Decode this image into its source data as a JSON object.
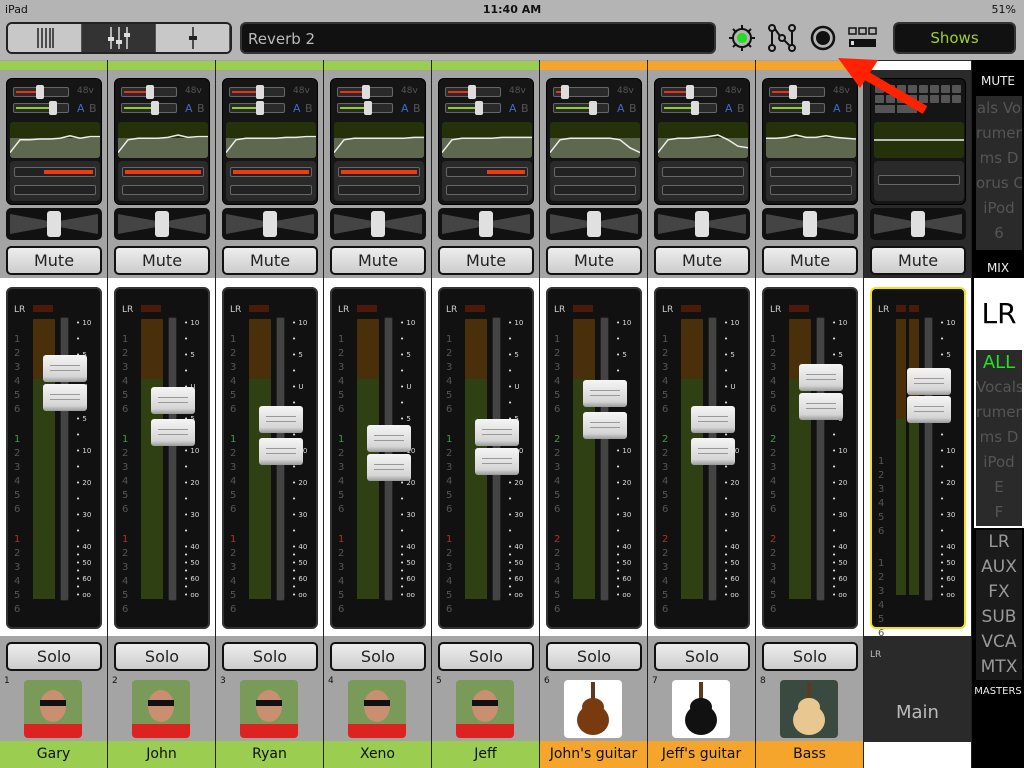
{
  "status": {
    "device": "iPad",
    "time": "11:40 AM",
    "battery": "51%"
  },
  "toolbar": {
    "views": [
      "channels-overview-icon",
      "mixer-faders-icon",
      "single-fader-icon"
    ],
    "active_view": 1,
    "scene_name": "Reverb 2",
    "shows_label": "Shows",
    "icons": [
      "gear-icon",
      "routing-icon",
      "record-icon",
      "layout-icon"
    ],
    "gear_status_color": "#22dd22"
  },
  "colors": {
    "green_group": "#9acd50",
    "orange_group": "#f5a52c",
    "meter_green": "#2f4012",
    "meter_orange": "#4a300a",
    "annotation_arrow": "#ff2200"
  },
  "fader_scale": [
    "10",
    "",
    "5",
    "",
    "U",
    "",
    "5",
    "",
    "10",
    "",
    "20",
    "",
    "30",
    "",
    "40",
    "",
    "50",
    "",
    "60",
    "",
    "oo"
  ],
  "meter_numbers": [
    "1",
    "2",
    "3",
    "4",
    "5",
    "6"
  ],
  "channels": [
    {
      "index": "1",
      "name": "Gary",
      "group": "green",
      "phantom": "48v",
      "ab": [
        "A",
        "B"
      ],
      "gain": 0.45,
      "trim": 0.72,
      "comp": [
        0.35,
        1
      ],
      "gate": null,
      "eq": [
        -9,
        -1,
        -1,
        -0.5,
        -0.5,
        0,
        1.5,
        0,
        1,
        1
      ],
      "fader_db": [
        3,
        -1.5
      ],
      "pan": 0,
      "mute": "Mute",
      "solo": "Solo",
      "photo": "person",
      "meter_marks": [
        "1",
        "1"
      ]
    },
    {
      "index": "2",
      "name": "John",
      "group": "green",
      "phantom": "48v",
      "ab": [
        "A",
        "B"
      ],
      "gain": 0.5,
      "trim": 0.6,
      "comp": [
        0,
        1
      ],
      "gate": null,
      "eq": [
        -9,
        -1,
        0,
        0,
        0,
        0.5,
        2,
        0.5,
        1,
        1
      ],
      "fader_db": [
        -2,
        -7
      ],
      "pan": 0,
      "mute": "Mute",
      "solo": "Solo",
      "photo": "person",
      "meter_marks": [
        "1",
        "1"
      ]
    },
    {
      "index": "3",
      "name": "Ryan",
      "group": "green",
      "phantom": "48v",
      "ab": [
        "A",
        "B"
      ],
      "gain": 0.55,
      "trim": 0.55,
      "comp": [
        0,
        1
      ],
      "gate": null,
      "eq": [
        -9,
        -1,
        0,
        0,
        0,
        0,
        0.5,
        0.5,
        1,
        1
      ],
      "fader_db": [
        -5,
        -10
      ],
      "pan": 0,
      "mute": "Mute",
      "solo": "Solo",
      "photo": "person",
      "meter_marks": [
        "1",
        "1"
      ]
    },
    {
      "index": "4",
      "name": "Xeno",
      "group": "green",
      "phantom": "48v",
      "ab": [
        "A",
        "B"
      ],
      "gain": 0.5,
      "trim": 0.55,
      "comp": [
        0,
        1
      ],
      "gate": null,
      "eq": [
        -9,
        -1,
        0,
        0,
        0,
        0,
        0,
        0,
        0.5,
        0.5
      ],
      "fader_db": [
        -8,
        -15
      ],
      "pan": 0,
      "mute": "Mute",
      "solo": "Solo",
      "photo": "person",
      "meter_marks": [
        "1",
        "1"
      ]
    },
    {
      "index": "5",
      "name": "Jeff",
      "group": "green",
      "phantom": "48v",
      "ab": [
        "A",
        "B"
      ],
      "gain": 0.45,
      "trim": 0.6,
      "comp": [
        0.5,
        1
      ],
      "gate": null,
      "eq": [
        -9,
        -1,
        0,
        0,
        0,
        0,
        0.5,
        0.5,
        0.5,
        0.5
      ],
      "fader_db": [
        -7,
        -13
      ],
      "pan": 0,
      "mute": "Mute",
      "solo": "Solo",
      "photo": "person",
      "meter_marks": [
        "1",
        "1"
      ]
    },
    {
      "index": "6",
      "name": "John's guitar",
      "group": "orange",
      "phantom": "48v",
      "ab": [
        "A",
        "B"
      ],
      "gain": 0.15,
      "trim": 0.72,
      "comp": null,
      "gate": null,
      "eq": [
        -9,
        -1,
        0,
        0,
        0,
        0,
        0,
        -1,
        -6,
        -9
      ],
      "fader_db": [
        -1,
        -6
      ],
      "pan": 0,
      "mute": "Mute",
      "solo": "Solo",
      "photo": "guitar-sunburst",
      "meter_marks": [
        "2",
        "2"
      ]
    },
    {
      "index": "7",
      "name": "Jeff's guitar",
      "group": "orange",
      "phantom": "48v",
      "ab": [
        "A",
        "B"
      ],
      "gain": 0.5,
      "trim": 0.6,
      "comp": null,
      "gate": null,
      "eq": [
        -9,
        -1,
        0,
        0,
        0.5,
        1,
        2,
        -1,
        -5,
        -6
      ],
      "fader_db": [
        -5,
        -10
      ],
      "pan": 0,
      "mute": "Mute",
      "solo": "Solo",
      "photo": "guitar-black",
      "meter_marks": [
        "2",
        "2"
      ]
    },
    {
      "index": "8",
      "name": "Bass",
      "group": "orange",
      "phantom": "48v",
      "ab": [
        "A",
        "B"
      ],
      "gain": 0.4,
      "trim": 0.67,
      "comp": null,
      "gate": null,
      "eq": [
        0,
        0,
        0.5,
        2,
        0.5,
        0.5,
        1.5,
        0.5,
        0,
        -0.5
      ],
      "fader_db": [
        1.5,
        -3
      ],
      "pan": 0,
      "mute": "Mute",
      "solo": "Solo",
      "photo": "bass",
      "meter_marks": [
        "2",
        "2"
      ]
    }
  ],
  "master": {
    "label": "LR",
    "name": "Main",
    "mute": "Mute",
    "fader_db": [
      1,
      -3.5
    ],
    "eq": [
      0,
      0,
      0,
      0,
      0,
      0,
      0,
      0,
      0,
      0
    ],
    "pan": 0
  },
  "sidebar": {
    "mute_label": "MUTE",
    "mute_groups": [
      "als  Vo",
      "rumen",
      "ms  D",
      "orus  C",
      "iPod",
      "6"
    ],
    "mix_label": "MIX",
    "mix_current": "LR",
    "mix_groups": [
      "ALL",
      "Vocals",
      "rumen",
      "ms  D",
      "iPod",
      "E",
      "F"
    ],
    "masters": [
      "LR",
      "AUX",
      "FX",
      "SUB",
      "VCA",
      "MTX"
    ],
    "masters_label": "MASTERS"
  }
}
